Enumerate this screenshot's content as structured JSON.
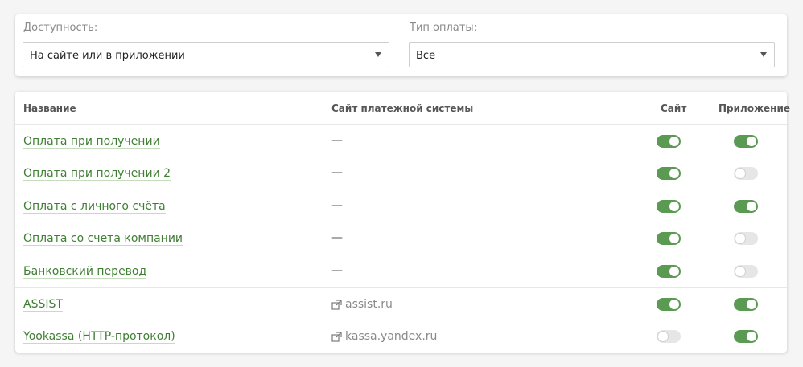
{
  "filters": {
    "availability": {
      "label": "Доступность:",
      "value": "На сайте или в приложении"
    },
    "payment_type": {
      "label": "Тип оплаты:",
      "value": "Все"
    }
  },
  "table": {
    "headers": {
      "name": "Название",
      "payment_site": "Сайт платежной системы",
      "site": "Сайт",
      "app": "Приложение"
    },
    "rows": [
      {
        "name": "Оплата при получении",
        "payment_site": "—",
        "site_enabled": true,
        "app_enabled": true
      },
      {
        "name": "Оплата при получении 2",
        "payment_site": "—",
        "site_enabled": true,
        "app_enabled": false
      },
      {
        "name": "Оплата с личного счёта",
        "payment_site": "—",
        "site_enabled": true,
        "app_enabled": true
      },
      {
        "name": "Оплата со счета компании",
        "payment_site": "—",
        "site_enabled": true,
        "app_enabled": false
      },
      {
        "name": "Банковский перевод",
        "payment_site": "—",
        "site_enabled": true,
        "app_enabled": false
      },
      {
        "name": "ASSIST",
        "payment_site": "assist.ru",
        "site_enabled": true,
        "app_enabled": true
      },
      {
        "name": "Yookassa (HTTP-протокол)",
        "payment_site": "kassa.yandex.ru",
        "site_enabled": false,
        "app_enabled": true
      }
    ]
  },
  "colors": {
    "accent": "#5a9a53",
    "link": "#3f7f33",
    "toggle_off": "#e6e6e6"
  },
  "icons": {
    "external": "external-link-icon",
    "dropdown": "chevron-down-icon"
  }
}
